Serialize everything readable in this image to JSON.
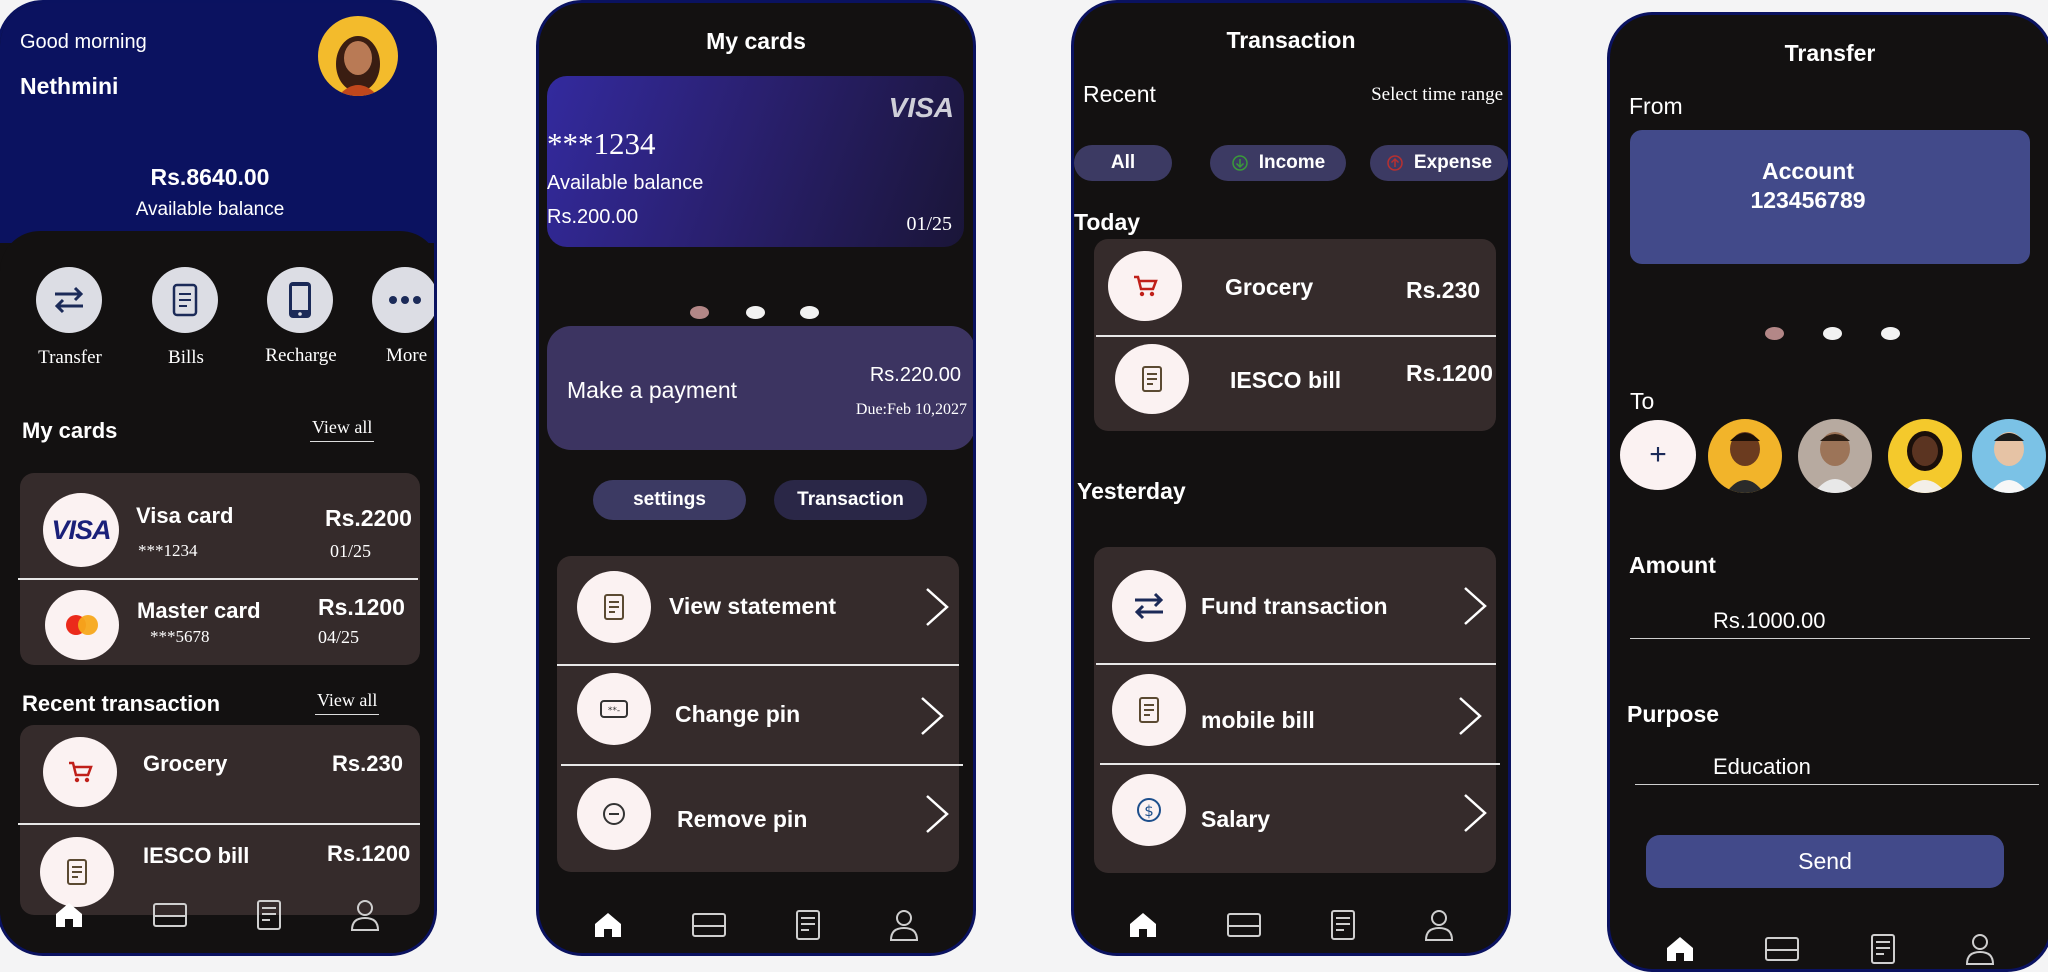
{
  "screen1": {
    "greeting": "Good morning",
    "user_name": "Nethmini",
    "balance": "Rs.8640.00",
    "balance_label": "Available balance",
    "actions": [
      {
        "label": "Transfer",
        "icon": "transfer-icon"
      },
      {
        "label": "Bills",
        "icon": "bill-icon"
      },
      {
        "label": "Recharge",
        "icon": "phone-icon"
      },
      {
        "label": "More",
        "icon": "more-icon"
      }
    ],
    "my_cards_title": "My cards",
    "my_cards_view_all": "View all",
    "cards": [
      {
        "name": "Visa card",
        "number": "***1234",
        "amount": "Rs.2200",
        "expiry": "01/25",
        "logo": "VISA"
      },
      {
        "name": "Master card",
        "number": "***5678",
        "amount": "Rs.1200",
        "expiry": "04/25"
      }
    ],
    "recent_title": "Recent transaction",
    "recent_view_all": "View all",
    "transactions": [
      {
        "name": "Grocery",
        "amount": "Rs.230",
        "icon": "cart-icon"
      },
      {
        "name": "IESCO bill",
        "amount": "Rs.1200",
        "icon": "bill-icon"
      }
    ]
  },
  "screen2": {
    "title": "My cards",
    "card": {
      "brand": "VISA",
      "number": "***1234",
      "balance_label": "Available balance",
      "balance": "Rs.200.00",
      "expiry": "01/25"
    },
    "payment": {
      "label": "Make a payment",
      "amount": "Rs.220.00",
      "due": "Due:Feb 10,2027"
    },
    "tabs": [
      "settings",
      "Transaction"
    ],
    "options": [
      {
        "label": "View statement",
        "icon": "statement-icon"
      },
      {
        "label": "Change pin",
        "icon": "pin-icon"
      },
      {
        "label": "Remove pin",
        "icon": "remove-icon"
      }
    ]
  },
  "screen3": {
    "title": "Transaction",
    "recent_label": "Recent",
    "time_range": "Select time range",
    "filters": [
      "All",
      "Income",
      "Expense"
    ],
    "today_label": "Today",
    "today": [
      {
        "name": "Grocery",
        "amount": "Rs.230",
        "icon": "cart-icon"
      },
      {
        "name": "IESCO bill",
        "amount": "Rs.1200",
        "icon": "bill-icon"
      }
    ],
    "yesterday_label": "Yesterday",
    "yesterday": [
      {
        "name": "Fund transaction",
        "icon": "transfer-icon"
      },
      {
        "name": "mobile bill",
        "icon": "bill-icon"
      },
      {
        "name": "Salary",
        "icon": "dollar-icon"
      }
    ]
  },
  "screen4": {
    "title": "Transfer",
    "from_label": "From",
    "account_line1": "Account",
    "account_line2": "123456789",
    "to_label": "To",
    "add_symbol": "+",
    "amount_label": "Amount",
    "amount_value": "Rs.1000.00",
    "purpose_label": "Purpose",
    "purpose_value": "Education",
    "send_label": "Send"
  },
  "colors": {
    "navy": "#0b1260",
    "panel": "#352b2b",
    "accent": "#424a8a",
    "pill": "#3c3a63",
    "background": "#131111"
  }
}
